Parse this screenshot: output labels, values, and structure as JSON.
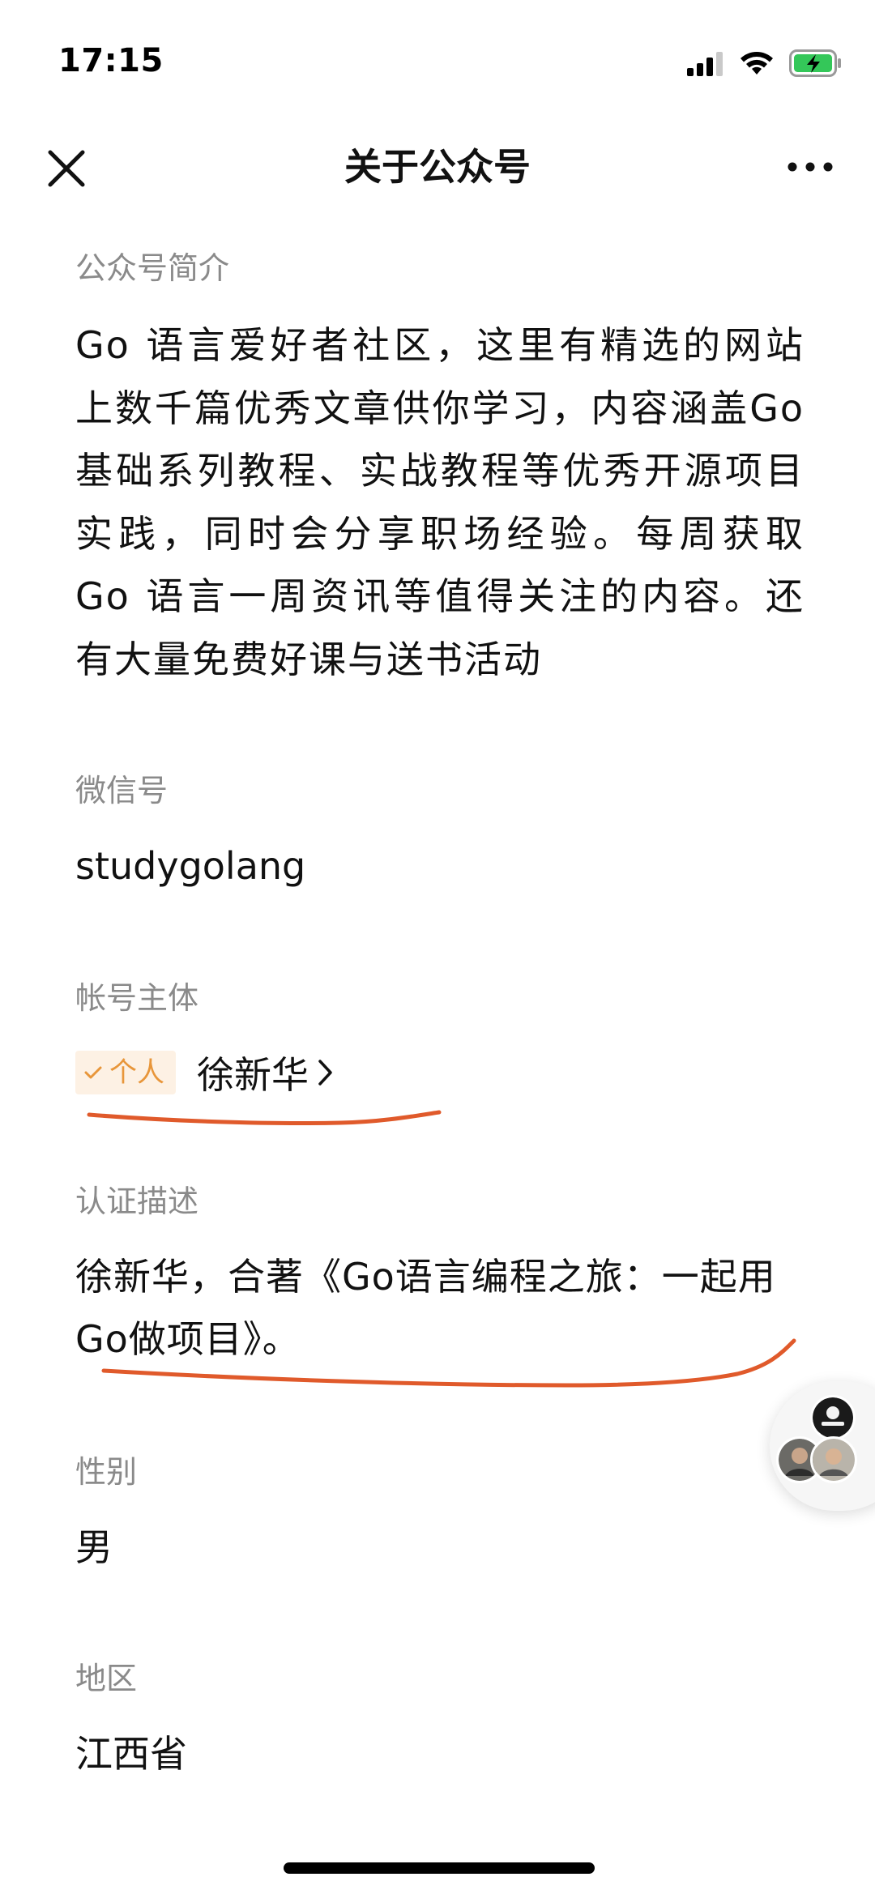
{
  "status_bar": {
    "time": "17:15",
    "icons": [
      "cellular-signal-icon",
      "wifi-icon",
      "battery-charging-icon"
    ]
  },
  "nav": {
    "title": "关于公众号",
    "close_icon": "close-icon",
    "more_icon": "more-icon"
  },
  "intro": {
    "label": "公众号简介",
    "text": "Go 语言爱好者社区，这里有精选的网站上数千篇优秀文章供你学习，内容涵盖Go基础系列教程、实战教程等优秀开源项目实践，同时会分享职场经验。每周获取 Go 语言一周资讯等值得关注的内容。还有大量免费好课与送书活动"
  },
  "wechat_id": {
    "label": "微信号",
    "value": "studygolang"
  },
  "owner": {
    "label": "帐号主体",
    "tag": "个人",
    "name": "徐新华"
  },
  "verification": {
    "label": "认证描述",
    "text": "徐新华，合著《Go语言编程之旅：一起用Go做项目》。"
  },
  "gender": {
    "label": "性别",
    "value": "男"
  },
  "region": {
    "label": "地区",
    "value": "江西省"
  },
  "colors": {
    "tag_text": "#e8963a",
    "tag_bg": "#fdf1e4",
    "label_gray": "#8a8a8a",
    "annotation_red": "#e05a2b"
  }
}
